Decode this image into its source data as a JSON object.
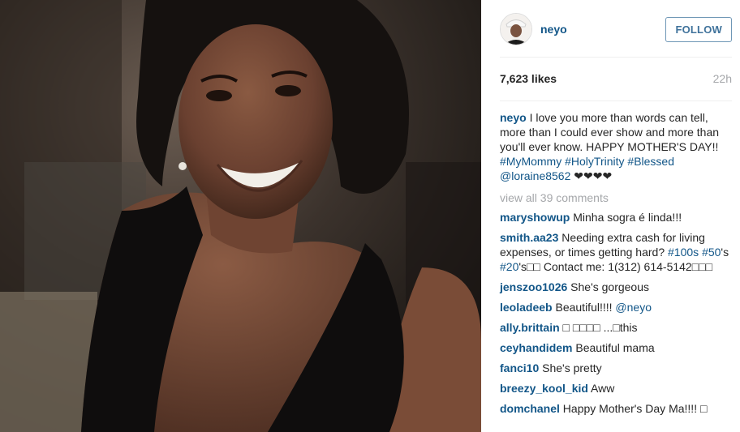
{
  "post": {
    "username": "neyo",
    "follow_label": "FOLLOW",
    "likes": "7,623 likes",
    "time": "22h",
    "caption_user": "neyo",
    "caption_text": " I love you more than words can tell, more than I could ever show and more than you'll ever know. HAPPY MOTHER'S DAY!! ",
    "caption_tags": [
      "#MyMommy",
      "#HolyTrinity",
      "#Blessed"
    ],
    "caption_mention": "@loraine8562",
    "caption_hearts": " ❤❤❤❤",
    "view_all": "view all 39 comments"
  },
  "comments": [
    {
      "user": "maryshowup",
      "text": " Minha sogra é linda!!!"
    },
    {
      "user": "smith.aa23",
      "text_a": " Needing extra cash for living expenses, or times getting hard? ",
      "tag1": "#100s",
      "mid1": " ",
      "tag2": "#50",
      "mid2": "'s ",
      "tag3": "#20",
      "text_b": "'s□□  Contact me: 1(312) 614-5142□□□"
    },
    {
      "user": "jenszoo1026",
      "text": " She's gorgeous"
    },
    {
      "user": "leoladeeb",
      "text": " Beautiful!!!! ",
      "mention": "@neyo"
    },
    {
      "user": "ally.brittain",
      "text": " □ □□□□ ...□this"
    },
    {
      "user": "ceyhandidem",
      "text": " Beautiful mama"
    },
    {
      "user": "fanci10",
      "text": " She's pretty"
    },
    {
      "user": "breezy_kool_kid",
      "text": " Aww"
    },
    {
      "user": "domchanel",
      "text": " Happy Mother's Day Ma!!!! □"
    }
  ],
  "colors": {
    "link": "#125688",
    "muted": "#a5a7aa",
    "follow": "#3f729b"
  }
}
